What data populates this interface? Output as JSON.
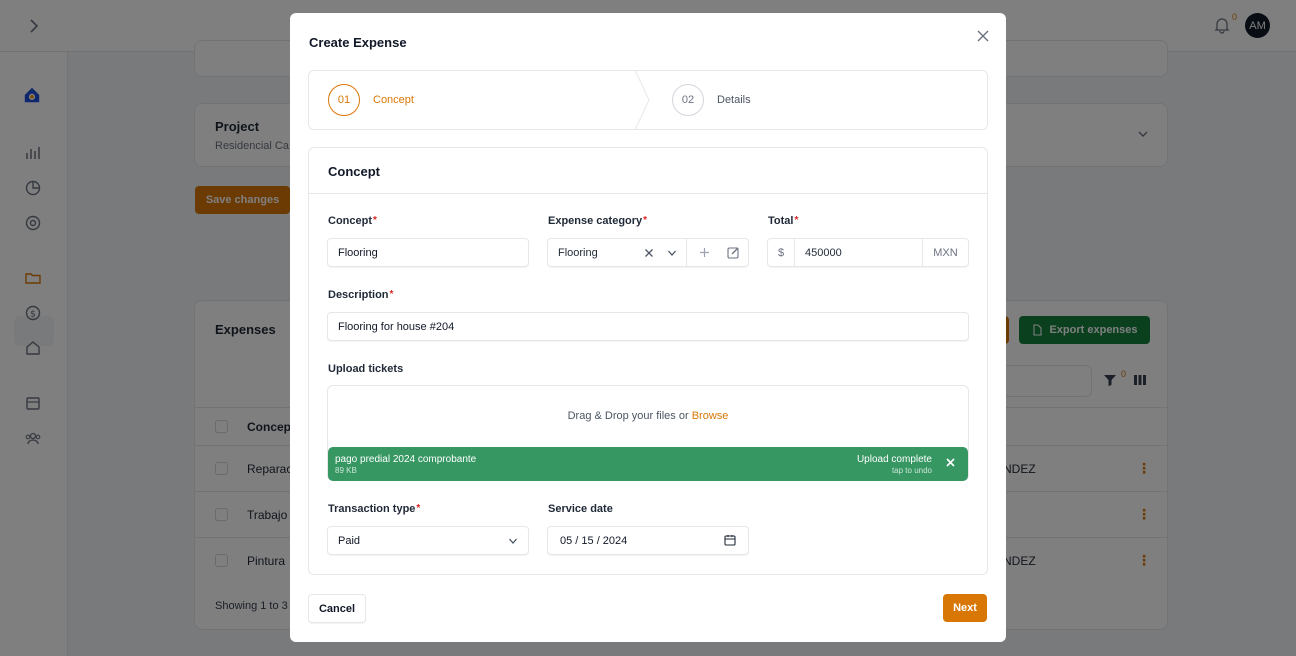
{
  "topbar": {
    "notification_count": "0",
    "avatar_initials": "AM"
  },
  "background": {
    "project_title": "Project",
    "project_subtitle": "Residencial Ca",
    "save_label": "Save changes",
    "expenses_title": "Expenses",
    "export_label": "Export expenses",
    "filter_count": "0",
    "column_header": "Concept",
    "rows": [
      {
        "concept": "Reparac",
        "right": "ENDEZ"
      },
      {
        "concept": "Trabajo",
        "right": ""
      },
      {
        "concept": "Pintura",
        "right": "ENDEZ"
      }
    ],
    "showing_text": "Showing 1 to 3"
  },
  "modal": {
    "title": "Create Expense",
    "steps": [
      {
        "number": "01",
        "label": "Concept",
        "active": true
      },
      {
        "number": "02",
        "label": "Details",
        "active": false
      }
    ],
    "section_title": "Concept",
    "fields": {
      "concept": {
        "label": "Concept",
        "value": "Flooring"
      },
      "category": {
        "label": "Expense category",
        "value": "Flooring"
      },
      "total": {
        "label": "Total",
        "prefix": "$",
        "value": "450000",
        "currency": "MXN"
      },
      "description": {
        "label": "Description",
        "value": "Flooring for house #204"
      },
      "upload": {
        "label": "Upload tickets",
        "drop_text": "Drag & Drop your files or",
        "browse_label": "Browse",
        "file_name": "pago predial 2024 comprobante",
        "file_size": "89 KB",
        "status": "Upload complete",
        "undo": "tap to undo"
      },
      "transaction_type": {
        "label": "Transaction type",
        "value": "Paid"
      },
      "service_date": {
        "label": "Service date",
        "value": "05 / 15 / 2024"
      }
    },
    "required_mark": "*",
    "cancel_label": "Cancel",
    "next_label": "Next"
  },
  "colors": {
    "accent": "#d97706",
    "success": "#369763",
    "export": "#15803d",
    "required": "#dc2626"
  }
}
